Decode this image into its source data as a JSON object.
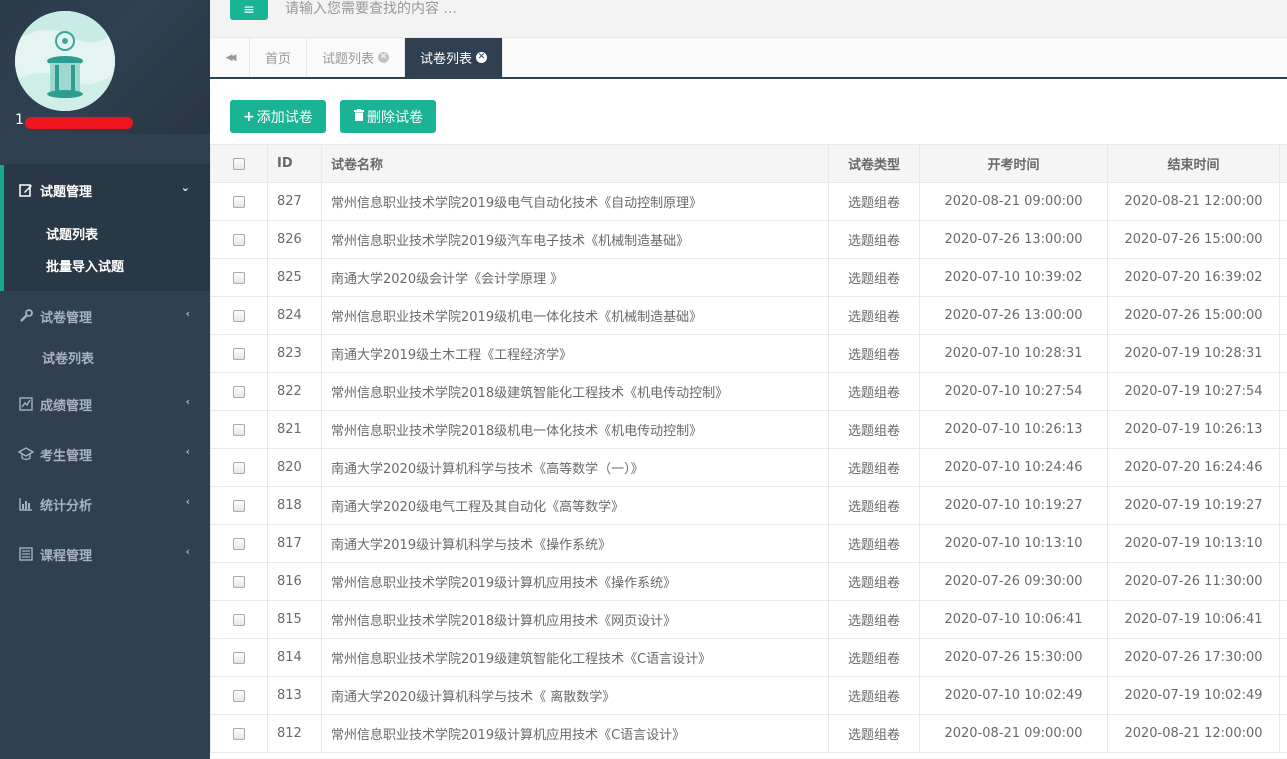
{
  "topbar": {
    "menu_icon": "≡",
    "search_placeholder": "请输入您需要查找的内容 ..."
  },
  "profile": {
    "username": "1"
  },
  "sidebar": {
    "groups": [
      {
        "label": "试题管理",
        "icon": "edit-icon",
        "active": true,
        "items": [
          "试题列表",
          "批量导入试题"
        ]
      },
      {
        "label": "试卷管理",
        "icon": "wrench-icon",
        "active": false,
        "items": [
          "试卷列表"
        ]
      },
      {
        "label": "成绩管理",
        "icon": "line-chart-icon",
        "active": false,
        "items": []
      },
      {
        "label": "考生管理",
        "icon": "graduation-cap-icon",
        "active": false,
        "items": []
      },
      {
        "label": "统计分析",
        "icon": "bar-chart-icon",
        "active": false,
        "items": []
      },
      {
        "label": "课程管理",
        "icon": "list-alt-icon",
        "active": false,
        "items": []
      }
    ]
  },
  "tabs": {
    "scroll_icon": "◀◀",
    "home": "首页",
    "items": [
      {
        "label": "试题列表",
        "active": false
      },
      {
        "label": "试卷列表",
        "active": true
      }
    ],
    "close_glyph": "✕"
  },
  "toolbar": {
    "add_label": "添加试卷",
    "add_icon": "+",
    "delete_label": "删除试卷"
  },
  "table": {
    "headers": [
      "ID",
      "试卷名称",
      "试卷类型",
      "开考时间",
      "结束时间"
    ],
    "rows": [
      [
        "827",
        "常州信息职业技术学院2019级电气自动化技术《自动控制原理》",
        "选题组卷",
        "2020-08-21 09:00:00",
        "2020-08-21 12:00:00"
      ],
      [
        "826",
        "常州信息职业技术学院2019级汽车电子技术《机械制造基础》",
        "选题组卷",
        "2020-07-26 13:00:00",
        "2020-07-26 15:00:00"
      ],
      [
        "825",
        "南通大学2020级会计学《会计学原理 》",
        "选题组卷",
        "2020-07-10 10:39:02",
        "2020-07-20 16:39:02"
      ],
      [
        "824",
        "常州信息职业技术学院2019级机电一体化技术《机械制造基础》",
        "选题组卷",
        "2020-07-26 13:00:00",
        "2020-07-26 15:00:00"
      ],
      [
        "823",
        "南通大学2019级土木工程《工程经济学》",
        "选题组卷",
        "2020-07-10 10:28:31",
        "2020-07-19 10:28:31"
      ],
      [
        "822",
        "常州信息职业技术学院2018级建筑智能化工程技术《机电传动控制》",
        "选题组卷",
        "2020-07-10 10:27:54",
        "2020-07-19 10:27:54"
      ],
      [
        "821",
        "常州信息职业技术学院2018级机电一体化技术《机电传动控制》",
        "选题组卷",
        "2020-07-10 10:26:13",
        "2020-07-19 10:26:13"
      ],
      [
        "820",
        "南通大学2020级计算机科学与技术《高等数学（一）》",
        "选题组卷",
        "2020-07-10 10:24:46",
        "2020-07-20 16:24:46"
      ],
      [
        "818",
        "南通大学2020级电气工程及其自动化《高等数学》",
        "选题组卷",
        "2020-07-10 10:19:27",
        "2020-07-19 10:19:27"
      ],
      [
        "817",
        "南通大学2019级计算机科学与技术《操作系统》",
        "选题组卷",
        "2020-07-10 10:13:10",
        "2020-07-19 10:13:10"
      ],
      [
        "816",
        "常州信息职业技术学院2019级计算机应用技术《操作系统》",
        "选题组卷",
        "2020-07-26 09:30:00",
        "2020-07-26 11:30:00"
      ],
      [
        "815",
        "常州信息职业技术学院2018级计算机应用技术《网页设计》",
        "选题组卷",
        "2020-07-10 10:06:41",
        "2020-07-19 10:06:41"
      ],
      [
        "814",
        "常州信息职业技术学院2019级建筑智能化工程技术《C语言设计》",
        "选题组卷",
        "2020-07-26 15:30:00",
        "2020-07-26 17:30:00"
      ],
      [
        "813",
        "南通大学2020级计算机科学与技术《 离散数学》",
        "选题组卷",
        "2020-07-10 10:02:49",
        "2020-07-19 10:02:49"
      ],
      [
        "812",
        "常州信息职业技术学院2019级计算机应用技术《C语言设计》",
        "选题组卷",
        "2020-08-21 09:00:00",
        "2020-08-21 12:00:00"
      ]
    ]
  }
}
